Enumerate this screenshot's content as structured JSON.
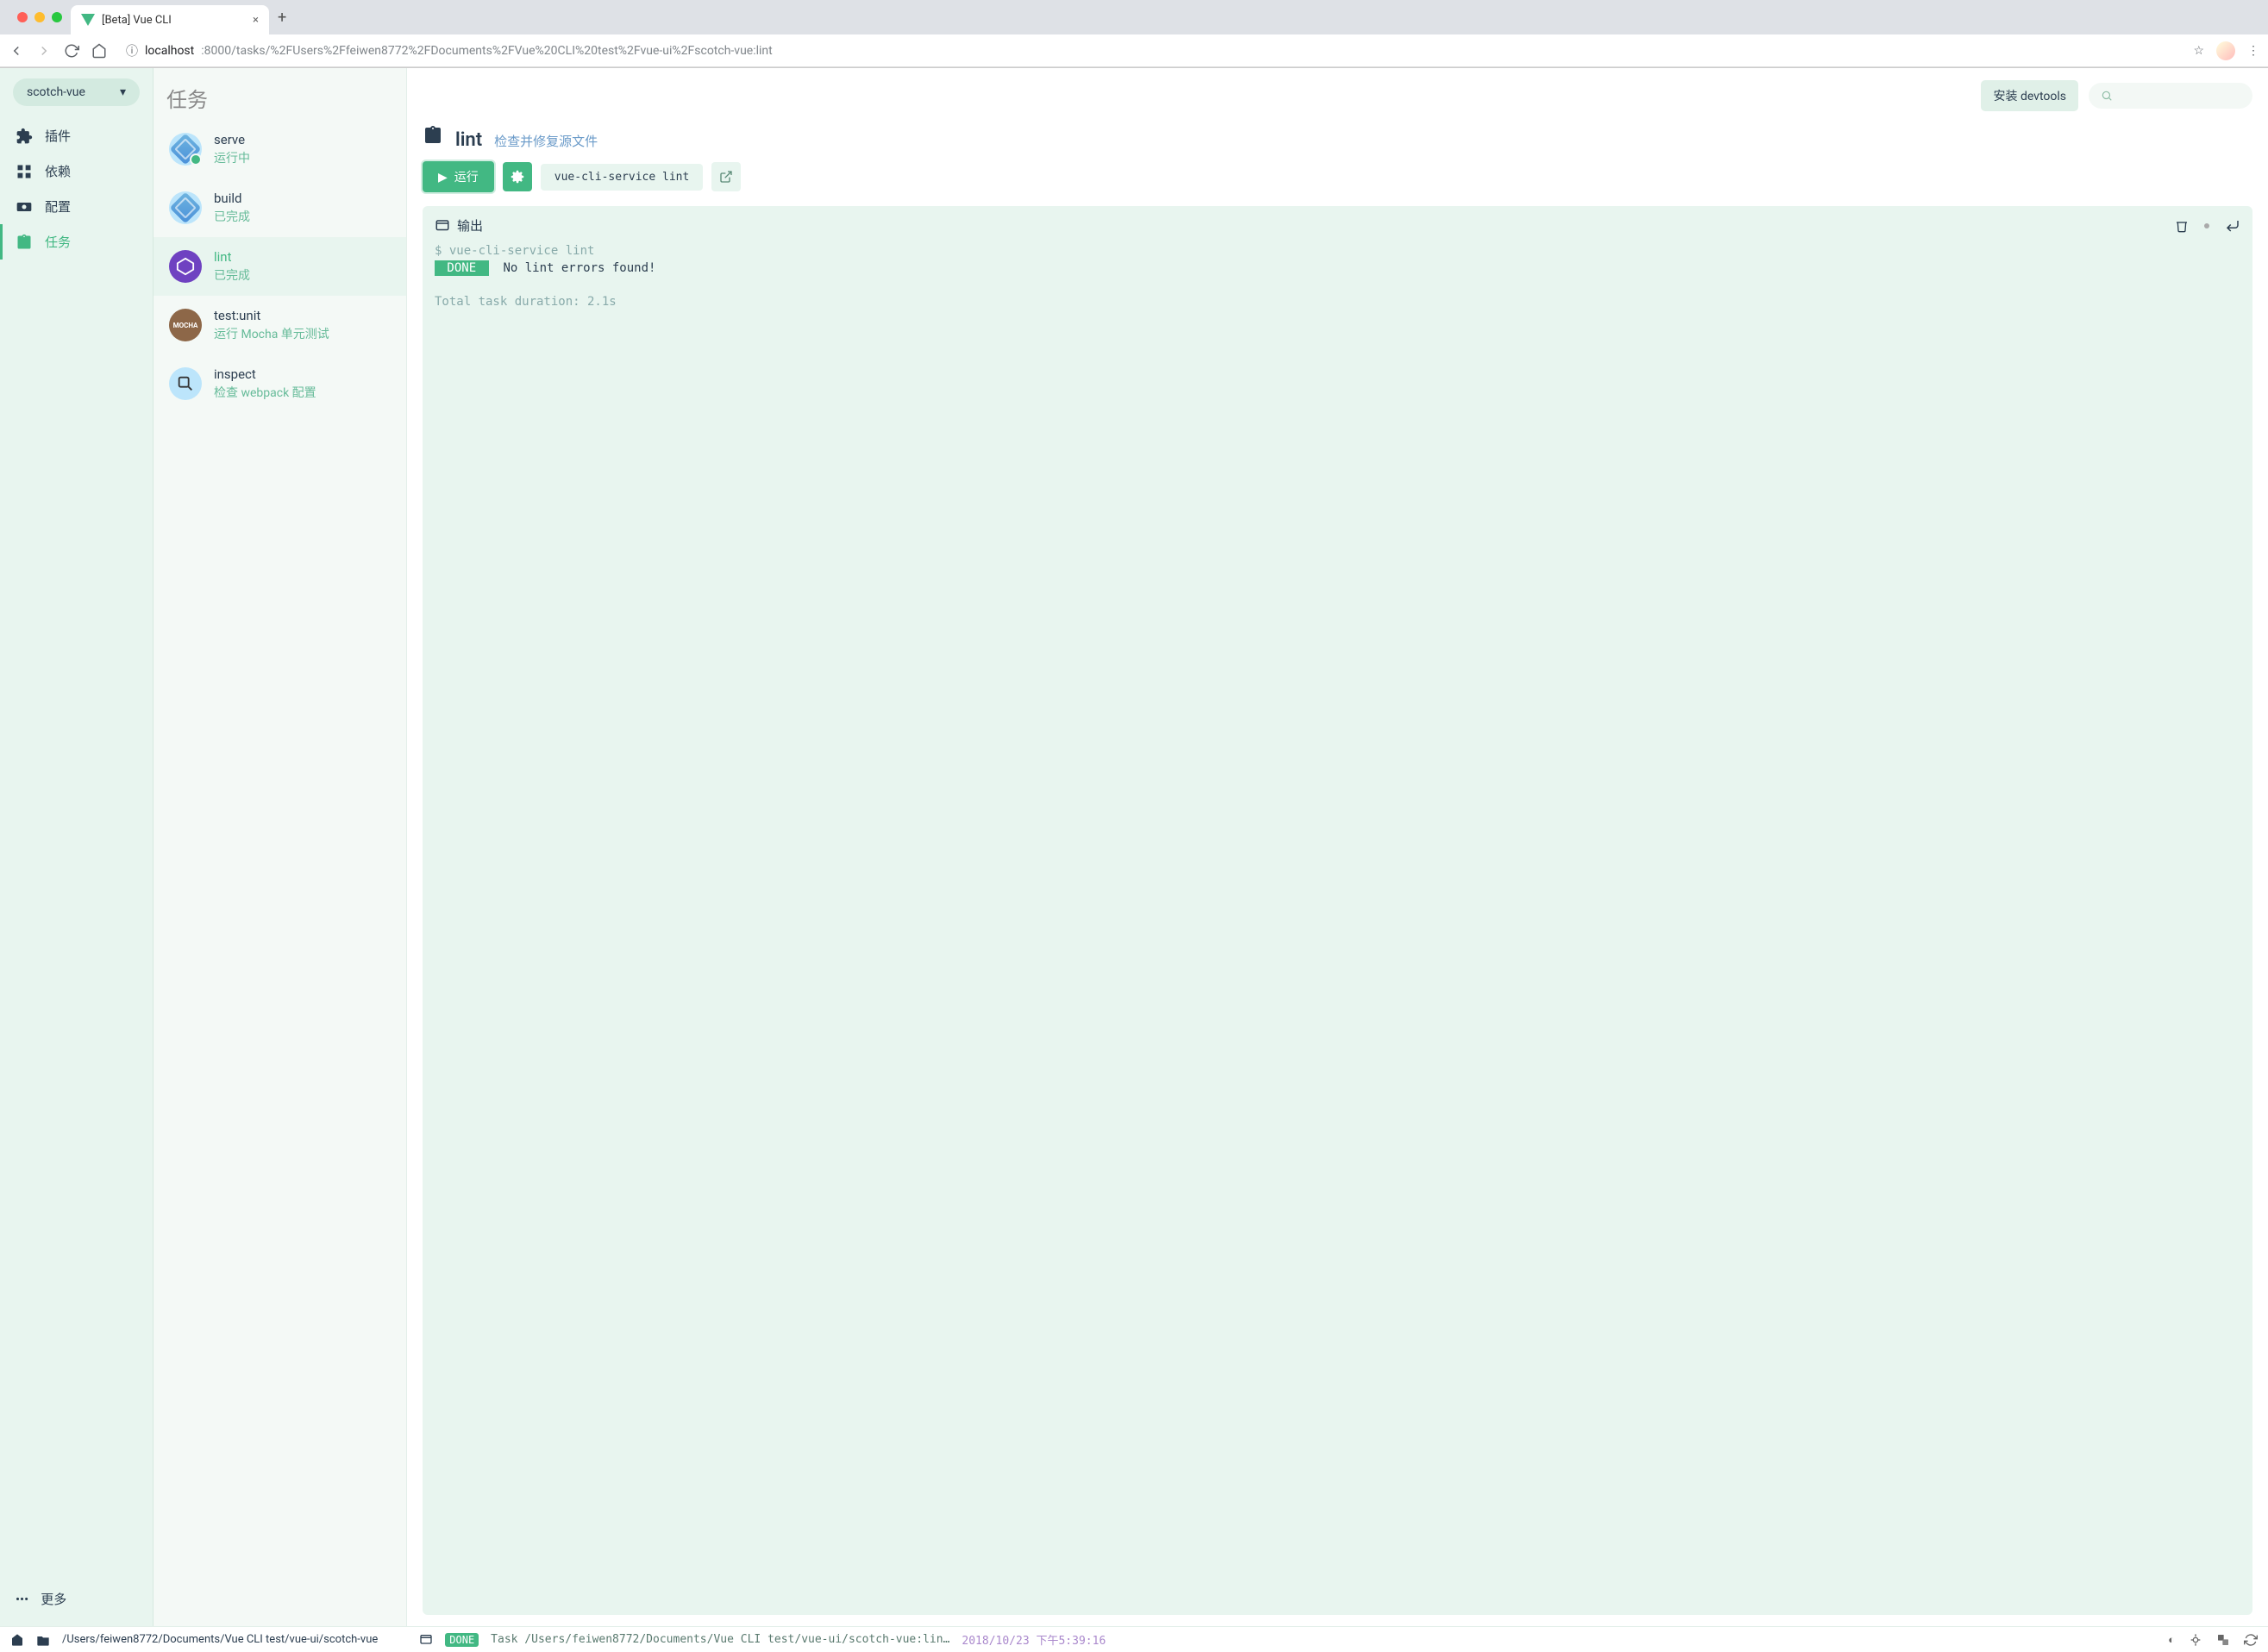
{
  "browser": {
    "tab_title": "[Beta] Vue CLI",
    "url_host": "localhost",
    "url_rest": ":8000/tasks/%2FUsers%2Ffeiwen8772%2FDocuments%2FVue%20CLI%20test%2Fvue-ui%2Fscotch-vue:lint"
  },
  "project": {
    "name": "scotch-vue"
  },
  "page_title": "任务",
  "nav": {
    "plugins": "插件",
    "dependencies": "依赖",
    "config": "配置",
    "tasks": "任务",
    "more": "更多"
  },
  "topbar": {
    "devtools": "安装 devtools"
  },
  "tasks": [
    {
      "name": "serve",
      "sub": "运行中"
    },
    {
      "name": "build",
      "sub": "已完成"
    },
    {
      "name": "lint",
      "sub": "已完成"
    },
    {
      "name": "test:unit",
      "sub": "运行 Mocha 单元测试"
    },
    {
      "name": "inspect",
      "sub": "检查 webpack 配置"
    }
  ],
  "detail": {
    "title": "lint",
    "desc": "检查并修复源文件",
    "run_label": "运行",
    "command": "vue-cli-service lint",
    "output_label": "输出",
    "terminal": {
      "prompt": "$ vue-cli-service lint",
      "done_badge": " DONE ",
      "done_msg": "No lint errors found!",
      "duration_line": "Total task duration: 2.1s"
    }
  },
  "statusbar": {
    "path": "/Users/feiwen8772/Documents/Vue CLI test/vue-ui/scotch-vue",
    "done_badge": "DONE",
    "task_line": "Task /Users/feiwen8772/Documents/Vue CLI test/vue-ui/scotch-vue:lin…",
    "timestamp": "2018/10/23 下午5:39:16"
  }
}
